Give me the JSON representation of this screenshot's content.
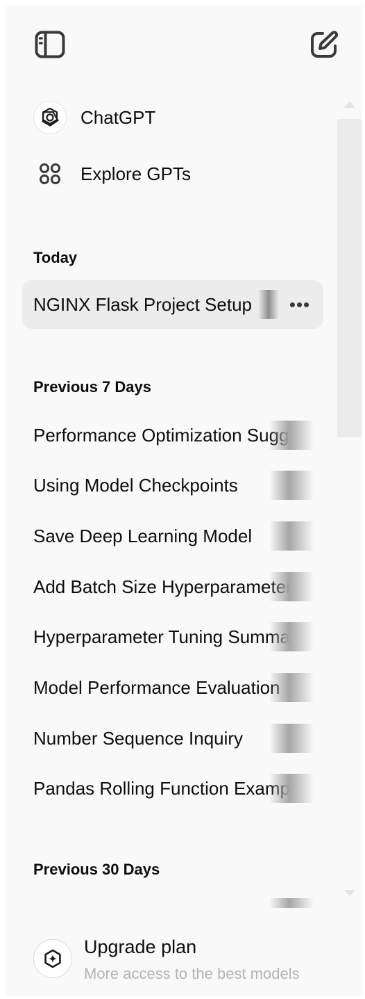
{
  "header": {
    "toggle_icon": "sidebar-toggle-icon",
    "new_chat_icon": "new-chat-pencil-icon"
  },
  "nav": {
    "chatgpt_label": "ChatGPT",
    "explore_label": "Explore GPTs"
  },
  "sections": {
    "today": {
      "heading": "Today",
      "items": [
        {
          "title": "NGINX Flask Project Setup"
        }
      ]
    },
    "previous_7": {
      "heading": "Previous 7 Days",
      "items": [
        {
          "title": "Performance Optimization Sugg"
        },
        {
          "title": "Using Model Checkpoints"
        },
        {
          "title": "Save Deep Learning Model"
        },
        {
          "title": "Add Batch Size Hyperparameter"
        },
        {
          "title": "Hyperparameter Tuning Summa"
        },
        {
          "title": "Model Performance Evaluation"
        },
        {
          "title": "Number Sequence Inquiry"
        },
        {
          "title": "Pandas Rolling Function Examp"
        }
      ]
    },
    "previous_30": {
      "heading": "Previous 30 Days"
    }
  },
  "more_options_glyph": "•••",
  "upgrade": {
    "title": "Upgrade plan",
    "subtitle": "More access to the best models"
  },
  "colors": {
    "sidebar_bg": "#f9f9f9",
    "active_item_bg": "#ececec",
    "text": "#0d0d0d",
    "muted_text": "#b4b4b4"
  }
}
